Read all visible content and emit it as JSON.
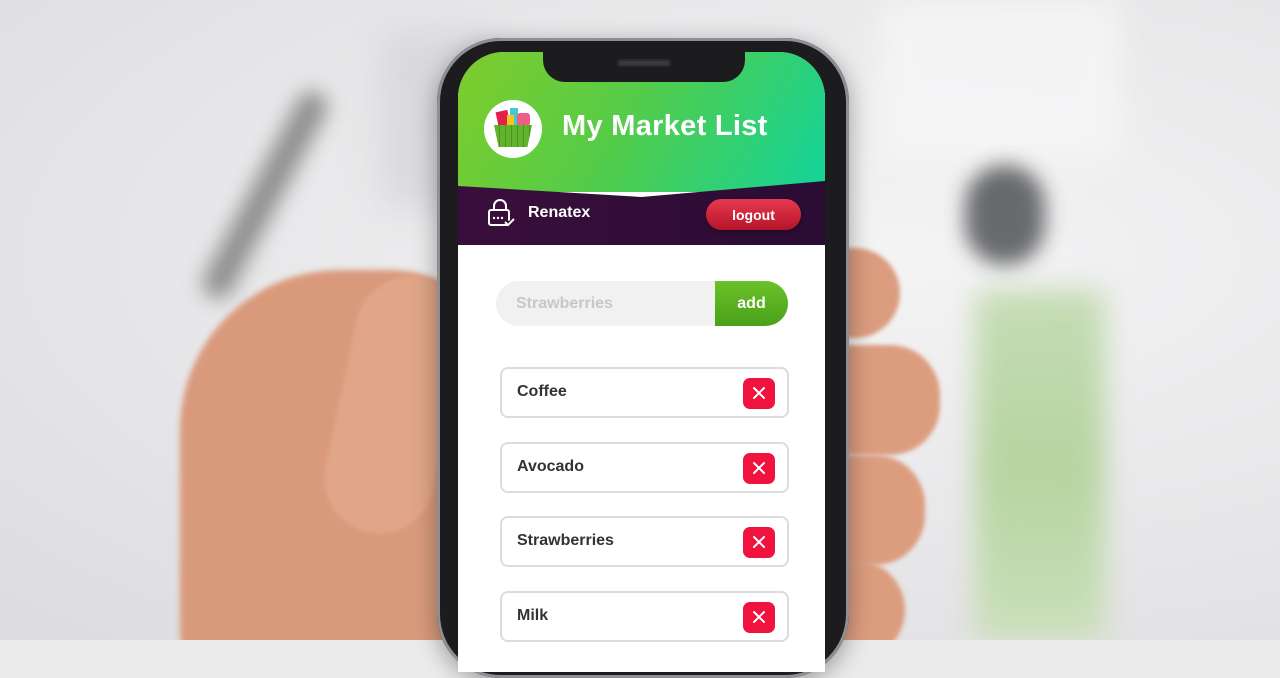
{
  "app": {
    "title": "My Market List",
    "logo_icon": "shopping-basket-icon"
  },
  "userbar": {
    "user_icon": "lock-icon",
    "username": "Renatex",
    "logout_label": "logout"
  },
  "add_form": {
    "placeholder": "Strawberries",
    "add_label": "add"
  },
  "items": [
    {
      "label": "Coffee",
      "delete_icon": "close-icon"
    },
    {
      "label": "Avocado",
      "delete_icon": "close-icon"
    },
    {
      "label": "Strawberries",
      "delete_icon": "close-icon"
    },
    {
      "label": "Milk",
      "delete_icon": "close-icon"
    }
  ],
  "colors": {
    "header_gradient_start": "#7fcc2a",
    "header_gradient_end": "#12d49a",
    "userbar_bg": "#2f0d36",
    "logout_red": "#d6203a",
    "add_green": "#5cb221",
    "delete_red": "#f0133f"
  }
}
